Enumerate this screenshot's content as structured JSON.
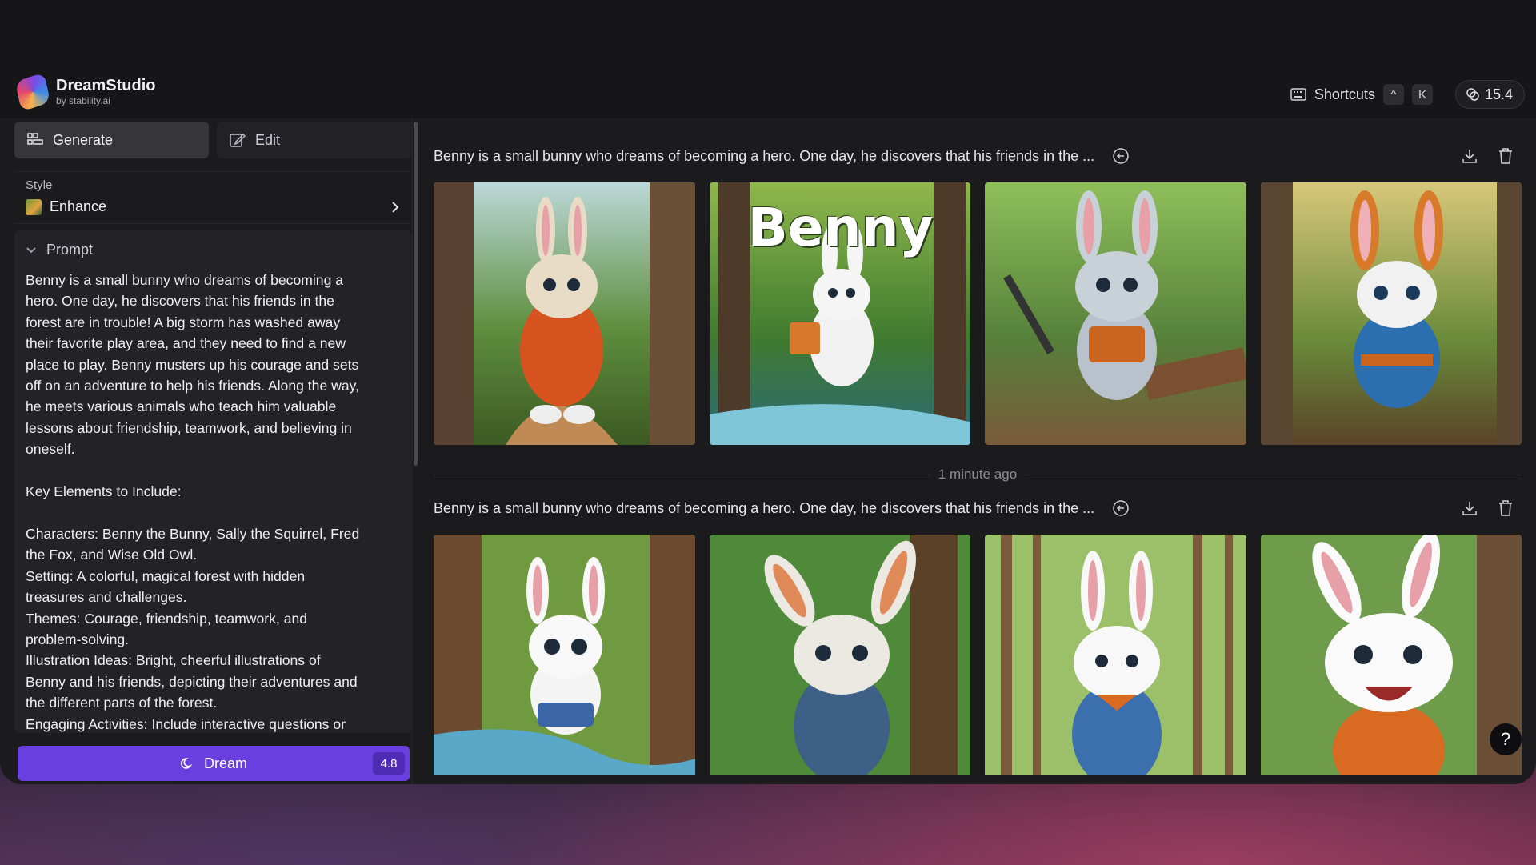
{
  "app": {
    "name": "DreamStudio",
    "by": "by stability.ai"
  },
  "header": {
    "shortcuts_label": "Shortcuts",
    "shortcut_keys": [
      "^",
      "K"
    ],
    "credits": "15.4"
  },
  "sidebar": {
    "tabs": [
      {
        "label": "Generate",
        "icon": "grid-icon",
        "active": true
      },
      {
        "label": "Edit",
        "icon": "edit-icon",
        "active": false
      }
    ],
    "style": {
      "label": "Style",
      "value": "Enhance"
    },
    "prompt": {
      "label": "Prompt",
      "text": "Benny is a small bunny who dreams of becoming a\nhero. One day, he discovers that his friends in the\nforest are in trouble! A big storm has washed away\ntheir favorite play area, and they need to find a new\nplace to play. Benny musters up his courage and sets\noff on an adventure to help his friends. Along the way,\nhe meets various animals who teach him valuable\nlessons about friendship, teamwork, and believing in\noneself.\n\nKey Elements to Include:\n\nCharacters: Benny the Bunny, Sally the Squirrel, Fred\nthe Fox, and Wise Old Owl.\nSetting: A colorful, magical forest with hidden\ntreasures and challenges.\nThemes: Courage, friendship, teamwork, and\nproblem-solving.\nIllustration Ideas: Bright, cheerful illustrations of\nBenny and his friends, depicting their adventures and\nthe different parts of the forest.\nEngaging Activities: Include interactive questions or"
    },
    "dream_button": {
      "label": "Dream",
      "cost": "4.8"
    }
  },
  "gallery": {
    "groups": [
      {
        "prompt": "Benny is a small bunny who dreams of becoming a hero. One day, he discovers that his friends in the ...",
        "images": 4,
        "cover_title": "Benny"
      },
      {
        "prompt": "Benny is a small bunny who dreams of becoming a hero. One day, he discovers that his friends in the ...",
        "images": 4
      }
    ],
    "separator": "1 minute ago"
  },
  "help_label": "?",
  "colors": {
    "accent": "#6a3fe0",
    "panel": "#232327",
    "background": "#1b1b1e"
  }
}
